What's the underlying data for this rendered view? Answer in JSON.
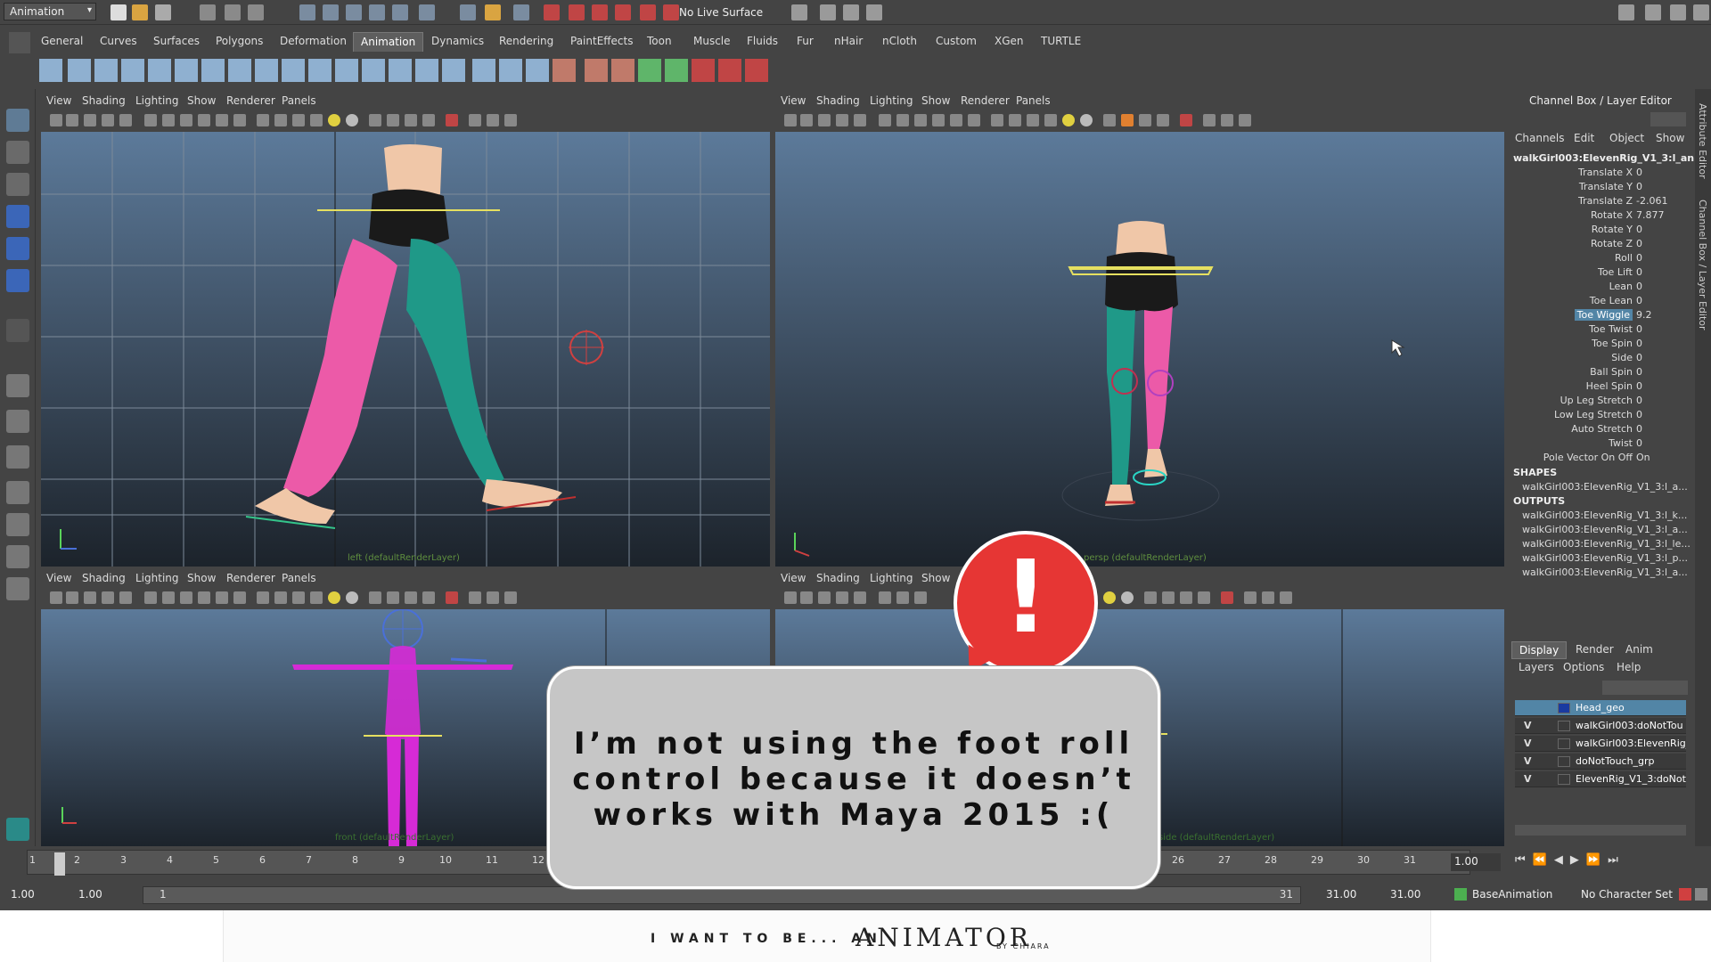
{
  "status_line": {
    "mode": "Animation",
    "live_surface": "No Live Surface"
  },
  "shelf_tabs": [
    "General",
    "Curves",
    "Surfaces",
    "Polygons",
    "Deformation",
    "Animation",
    "Dynamics",
    "Rendering",
    "PaintEffects",
    "Toon",
    "Muscle",
    "Fluids",
    "Fur",
    "nHair",
    "nCloth",
    "Custom",
    "XGen",
    "TURTLE"
  ],
  "active_shelf": "Animation",
  "viewport_menu": [
    "View",
    "Shading",
    "Lighting",
    "Show",
    "Renderer",
    "Panels"
  ],
  "viewports": [
    {
      "label": "left (defaultRenderLayer)"
    },
    {
      "label": "persp (defaultRenderLayer)"
    },
    {
      "label": "front (defaultRenderLayer)"
    },
    {
      "label": "side (defaultRenderLayer)"
    }
  ],
  "channel_box": {
    "title": "Channel Box / Layer Editor",
    "menu": [
      "Channels",
      "Edit",
      "Object",
      "Show"
    ],
    "node": "walkGirl003:ElevenRig_V1_3:l_an...",
    "channels": [
      {
        "label": "Translate X",
        "value": "0"
      },
      {
        "label": "Translate Y",
        "value": "0"
      },
      {
        "label": "Translate Z",
        "value": "-2.061"
      },
      {
        "label": "Rotate X",
        "value": "7.877"
      },
      {
        "label": "Rotate Y",
        "value": "0"
      },
      {
        "label": "Rotate Z",
        "value": "0"
      },
      {
        "label": "Roll",
        "value": "0"
      },
      {
        "label": "Toe Lift",
        "value": "0"
      },
      {
        "label": "Lean",
        "value": "0"
      },
      {
        "label": "Toe Lean",
        "value": "0"
      },
      {
        "label": "Toe Wiggle",
        "value": "9.2",
        "selected": true
      },
      {
        "label": "Toe Twist",
        "value": "0"
      },
      {
        "label": "Toe Spin",
        "value": "0"
      },
      {
        "label": "Side",
        "value": "0"
      },
      {
        "label": "Ball Spin",
        "value": "0"
      },
      {
        "label": "Heel Spin",
        "value": "0"
      },
      {
        "label": "Up Leg Stretch",
        "value": "0"
      },
      {
        "label": "Low Leg Stretch",
        "value": "0"
      },
      {
        "label": "Auto Stretch",
        "value": "0"
      },
      {
        "label": "Twist",
        "value": "0"
      },
      {
        "label": "Pole Vector On Off",
        "value": "On"
      }
    ],
    "shapes_header": "SHAPES",
    "shapes": [
      "walkGirl003:ElevenRig_V1_3:l_a..."
    ],
    "outputs_header": "OUTPUTS",
    "outputs": [
      "walkGirl003:ElevenRig_V1_3:l_k...",
      "walkGirl003:ElevenRig_V1_3:l_a...",
      "walkGirl003:ElevenRig_V1_3:l_le...",
      "walkGirl003:ElevenRig_V1_3:l_p...",
      "walkGirl003:ElevenRig_V1_3:l_a..."
    ]
  },
  "layer_editor": {
    "tabs": [
      "Display",
      "Render",
      "Anim"
    ],
    "menu": [
      "Layers",
      "Options",
      "Help"
    ],
    "layers": [
      {
        "v": "",
        "name": "Head_geo",
        "selected": true
      },
      {
        "v": "V",
        "name": "walkGirl003:doNotTou"
      },
      {
        "v": "V",
        "name": "walkGirl003:ElevenRig_"
      },
      {
        "v": "V",
        "name": "doNotTouch_grp"
      },
      {
        "v": "V",
        "name": "ElevenRig_V1_3:doNot"
      }
    ]
  },
  "side_tabs": [
    "Attribute Editor",
    "Channel Box / Layer Editor"
  ],
  "time_slider": {
    "ticks": [
      "1",
      "2",
      "3",
      "4",
      "5",
      "6",
      "7",
      "8",
      "9",
      "10",
      "11",
      "12",
      "26",
      "27",
      "28",
      "29",
      "30",
      "31"
    ],
    "current_time": "1.00"
  },
  "range_slider": {
    "start": "1.00",
    "anim_start": "1.00",
    "range_start": "1",
    "range_end": "31",
    "anim_end": "31.00",
    "end": "31.00",
    "anim_layer": "BaseAnimation",
    "character_set": "No Character Set"
  },
  "callout": {
    "text": "I’m not using the foot roll\ncontrol because it doesn’t\nworks with Maya 2015 :(",
    "bubble": "!"
  },
  "footer": {
    "text": "I WANT TO BE...   AN",
    "brand": "ANIMATOR",
    "by": "BY CHIARA"
  }
}
